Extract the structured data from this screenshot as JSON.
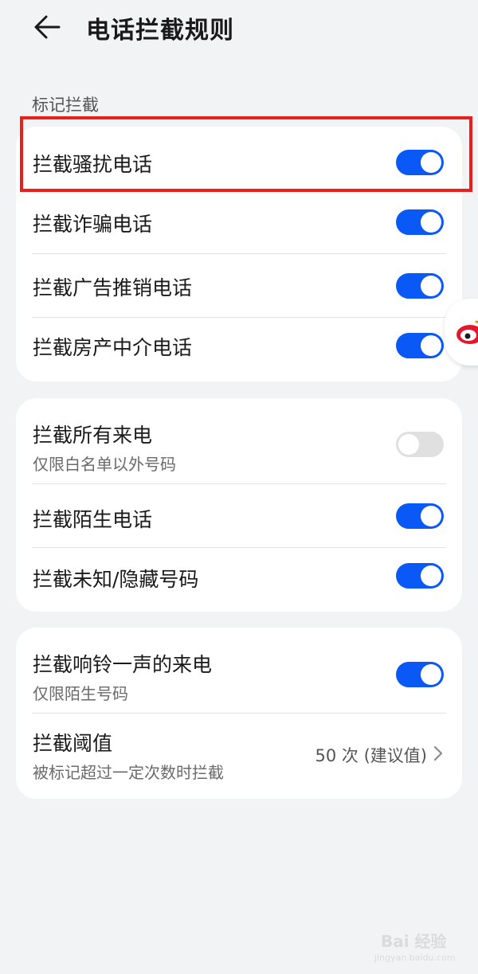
{
  "header": {
    "title": "电话拦截规则",
    "back_icon": "arrow-left-icon"
  },
  "section_marked": {
    "label": "标记拦截",
    "items": [
      {
        "title": "拦截骚扰电话",
        "enabled": true
      },
      {
        "title": "拦截诈骗电话",
        "enabled": true
      },
      {
        "title": "拦截广告推销电话",
        "enabled": true
      },
      {
        "title": "拦截房产中介电话",
        "enabled": true
      }
    ]
  },
  "section_calls": {
    "items": [
      {
        "title": "拦截所有来电",
        "subtitle": "仅限白名单以外号码",
        "enabled": false
      },
      {
        "title": "拦截陌生电话",
        "enabled": true
      },
      {
        "title": "拦截未知/隐藏号码",
        "enabled": true
      }
    ]
  },
  "section_ring": {
    "ring_once": {
      "title": "拦截响铃一声的来电",
      "subtitle": "仅限陌生号码",
      "enabled": true
    },
    "threshold": {
      "title": "拦截阈值",
      "subtitle": "被标记超过一定次数时拦截",
      "value": "50 次 (建议值)"
    }
  },
  "colors": {
    "accent": "#0a59f7",
    "background": "#f1f3f5",
    "card": "#ffffff",
    "highlight": "#e8201c"
  },
  "watermark": {
    "text": "Bai 经验",
    "sub": "jingyan.baidu.com"
  }
}
